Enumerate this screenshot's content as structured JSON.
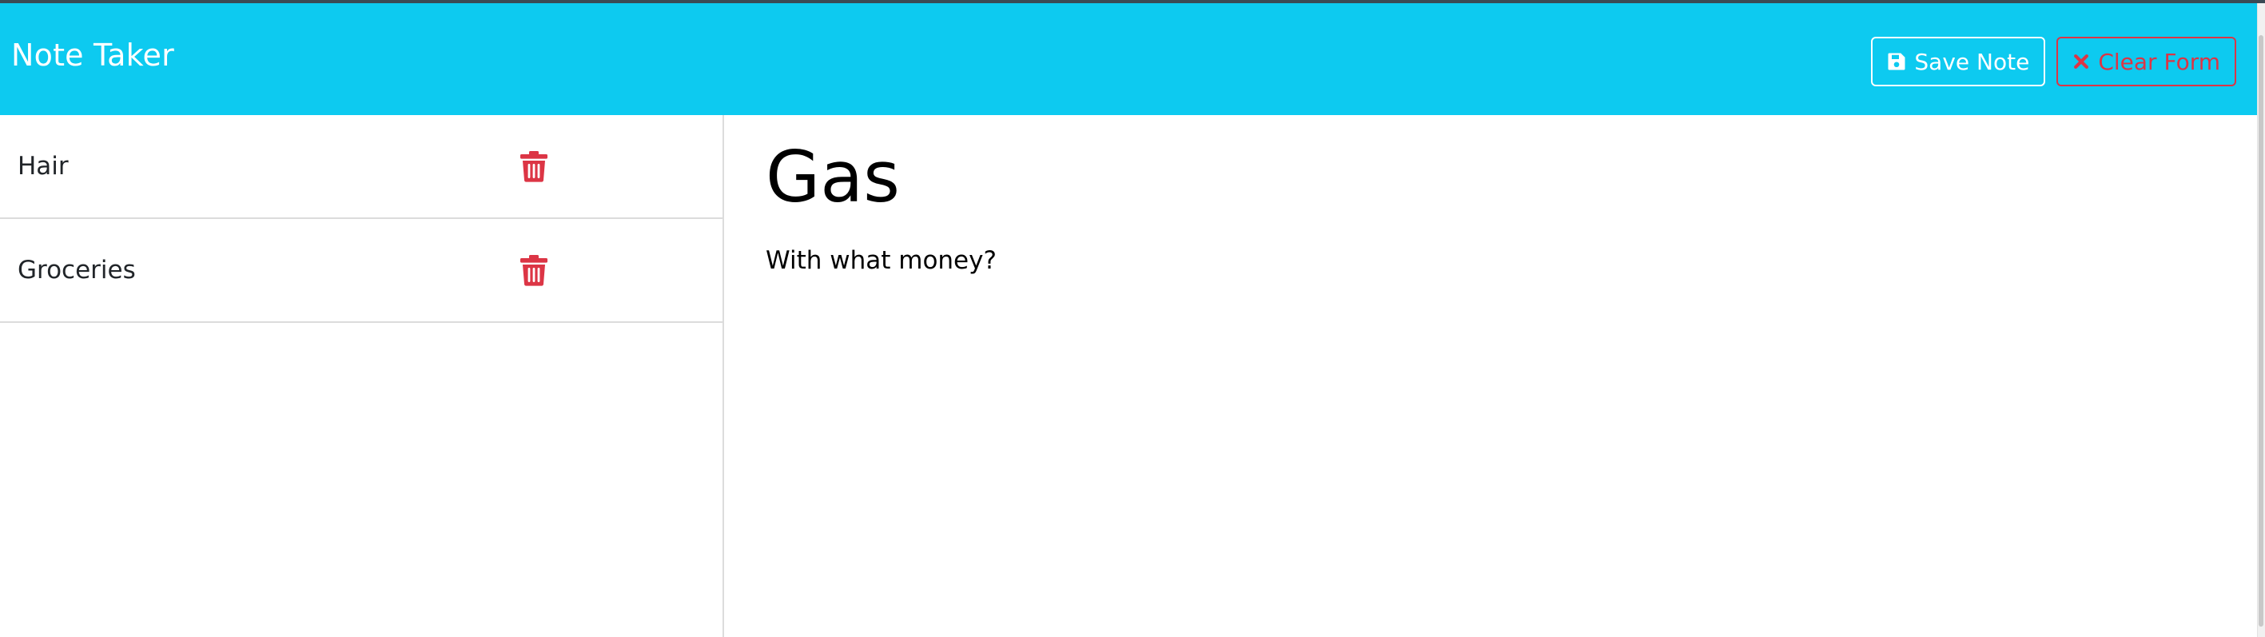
{
  "colors": {
    "navbar_bg": "#0dcaf0",
    "danger": "#dc3545",
    "white": "#ffffff"
  },
  "navbar": {
    "brand": "Note Taker",
    "save_label": "Save Note",
    "save_icon": "floppy-disk-icon",
    "clear_label": "Clear Form",
    "clear_icon": "x-icon"
  },
  "notes": [
    {
      "title": "Hair",
      "delete_icon": "trash-icon"
    },
    {
      "title": "Groceries",
      "delete_icon": "trash-icon"
    }
  ],
  "active_note": {
    "title": "Gas",
    "text": "With what money?"
  }
}
